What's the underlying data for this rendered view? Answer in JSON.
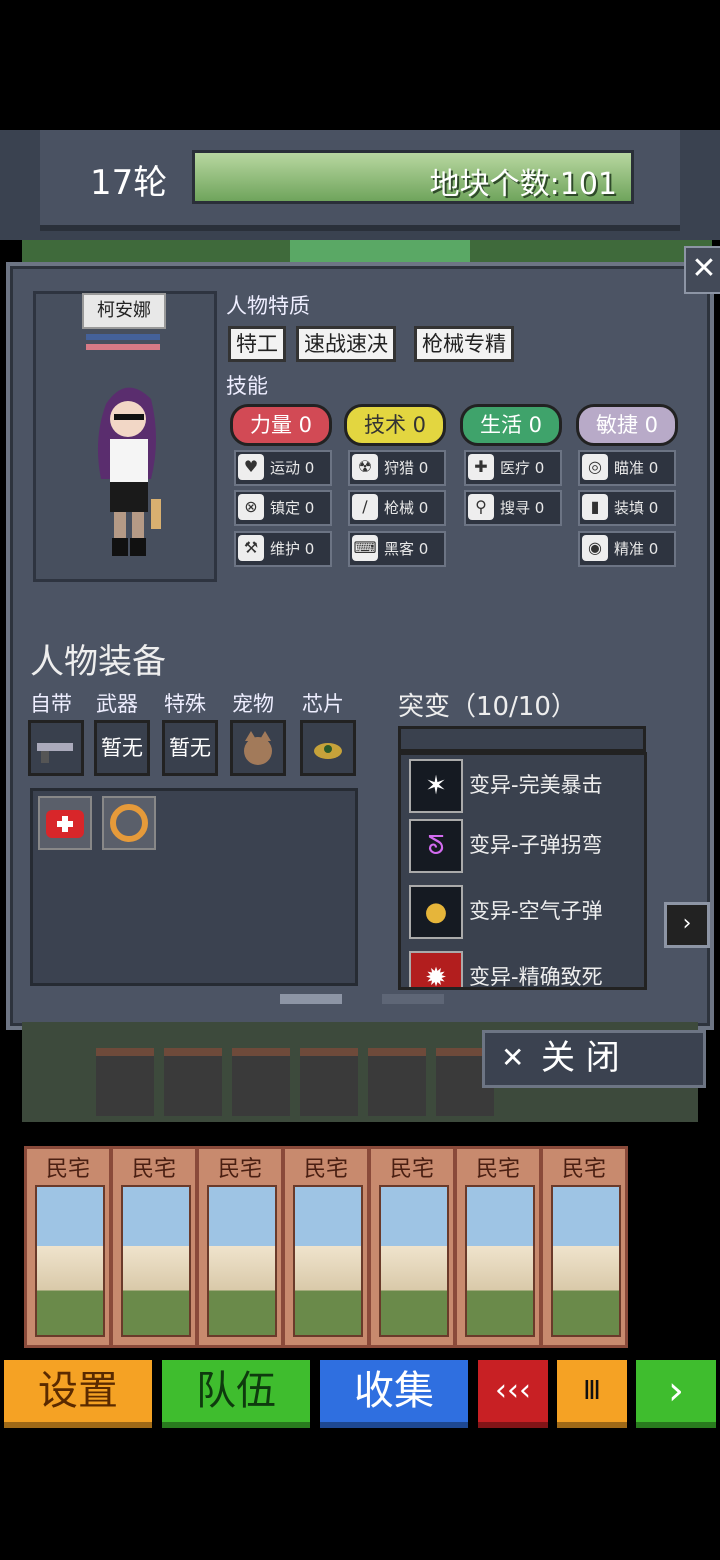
{
  "header": {
    "round": "17轮",
    "tile_count": "地块个数:101"
  },
  "character": {
    "name": "柯安娜",
    "traits_label": "人物特质",
    "traits": [
      "特工",
      "速战速决",
      "枪械专精"
    ],
    "skills_label": "技能",
    "attributes": [
      {
        "label": "力量 0",
        "color": "#d24a55"
      },
      {
        "label": "技术 0",
        "color": "#e3d640"
      },
      {
        "label": "生活 0",
        "color": "#3fa36b"
      },
      {
        "label": "敏捷 0",
        "color": "#b8aac8"
      }
    ],
    "skills": [
      {
        "icon": "heart-icon",
        "glyph": "♥",
        "label": "运动 0"
      },
      {
        "icon": "radiation-icon",
        "glyph": "☢",
        "label": "狩猎 0"
      },
      {
        "icon": "medkit-icon",
        "glyph": "✚",
        "label": "医疗 0"
      },
      {
        "icon": "crosshair-icon",
        "glyph": "◎",
        "label": "瞄准 0"
      },
      {
        "icon": "lock-icon",
        "glyph": "⊗",
        "label": "镇定 0"
      },
      {
        "icon": "knife-icon",
        "glyph": "∕",
        "label": "枪械 0"
      },
      {
        "icon": "magnifier-icon",
        "glyph": "⚲",
        "label": "搜寻 0"
      },
      {
        "icon": "magazine-icon",
        "glyph": "▮",
        "label": "装填 0"
      },
      {
        "icon": "wrench-icon",
        "glyph": "⚒",
        "label": "维护 0"
      },
      {
        "icon": "hacker-icon",
        "glyph": "⌨",
        "label": "黑客 0"
      },
      {
        "icon": "eye-icon",
        "glyph": "◉",
        "label": "精准 0"
      }
    ]
  },
  "equipment": {
    "title": "人物装备",
    "slot_labels": [
      "自带",
      "武器",
      "特殊",
      "宠物",
      "芯片"
    ],
    "slots": [
      "",
      "暂无",
      "暂无",
      "",
      ""
    ],
    "inventory": [
      "medkit-icon",
      "ring-icon"
    ]
  },
  "mutations": {
    "title": "突变（10/10）",
    "items": [
      "变异-完美暴击",
      "变异-子弹拐弯",
      "变异-空气子弹",
      "变异-精确致死"
    ]
  },
  "close_button": "关  闭",
  "cards": [
    "民宅",
    "民宅",
    "民宅",
    "民宅",
    "民宅",
    "民宅",
    "民宅"
  ],
  "bottom_bar": {
    "settings": "设置",
    "team": "队伍",
    "collect": "收集",
    "rewind": "‹‹‹",
    "pause": "Ⅲ",
    "forward": "›"
  }
}
